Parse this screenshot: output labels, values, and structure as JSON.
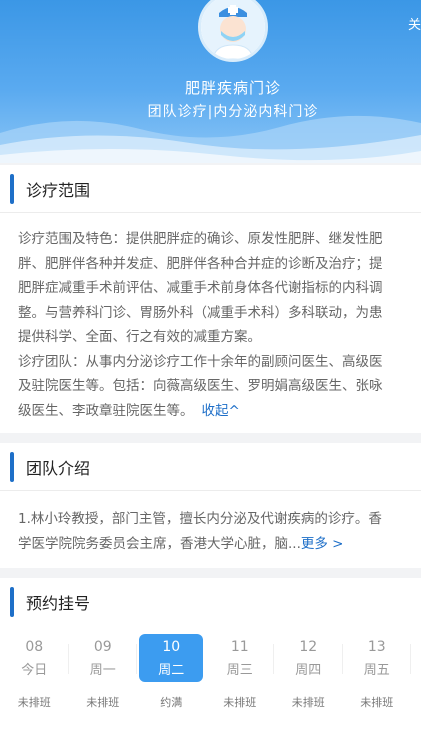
{
  "header": {
    "title": "肥胖疾病门诊",
    "subtitle": "团队诊疗|内分泌内科门诊",
    "follow": "关"
  },
  "scope": {
    "section_title": "诊疗范围",
    "lines": [
      "诊疗范围及特色：提供肥胖症的确诊、原发性肥胖、继发性肥",
      "胖、肥胖伴各种并发症、肥胖伴各种合并症的诊断及治疗；提",
      "肥胖症减重手术前评估、减重手术前身体各代谢指标的内科调",
      "整。与营养科门诊、胃肠外科（减重手术科）多科联动，为患",
      "提供科学、全面、行之有效的减重方案。",
      "诊疗团队：从事内分泌诊疗工作十余年的副顾问医生、高级医",
      "及驻院医生等。包括：向薇高级医生、罗明娟高级医生、张咏",
      "级医生、李政章驻院医生等。"
    ],
    "collapse": "收起^"
  },
  "team": {
    "section_title": "团队介绍",
    "line1": "1.林小玲教授，部门主管，擅长内分泌及代谢疾病的诊疗。香",
    "line2": "学医学院院务委员会主席，香港大学心脏，脑...",
    "more": "更多 >"
  },
  "booking": {
    "section_title": "预约挂号",
    "days": [
      {
        "date": "08",
        "weekday": "今日",
        "status": "未排班",
        "active": false
      },
      {
        "date": "09",
        "weekday": "周一",
        "status": "未排班",
        "active": false
      },
      {
        "date": "10",
        "weekday": "周二",
        "status": "约满",
        "active": true
      },
      {
        "date": "11",
        "weekday": "周三",
        "status": "未排班",
        "active": false
      },
      {
        "date": "12",
        "weekday": "周四",
        "status": "未排班",
        "active": false
      },
      {
        "date": "13",
        "weekday": "周五",
        "status": "未排班",
        "active": false
      }
    ]
  }
}
